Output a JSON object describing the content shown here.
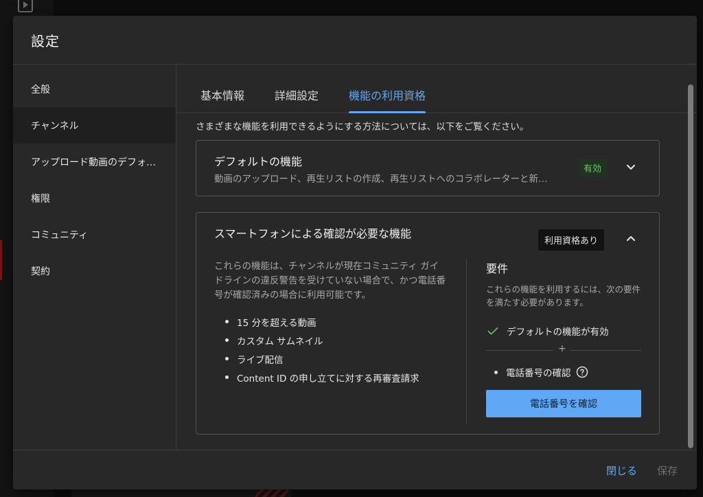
{
  "dialog": {
    "title": "設定"
  },
  "sidebar": {
    "items": [
      {
        "label": "全般"
      },
      {
        "label": "チャンネル"
      },
      {
        "label": "アップロード動画のデフォ…"
      },
      {
        "label": "権限"
      },
      {
        "label": "コミュニティ"
      },
      {
        "label": "契約"
      }
    ],
    "active_index": 1
  },
  "tabs": [
    {
      "label": "基本情報"
    },
    {
      "label": "詳細設定"
    },
    {
      "label": "機能の利用資格"
    }
  ],
  "active_tab_index": 2,
  "intro_text": "さまざまな機能を利用できるようにする方法については、以下をご覧ください。",
  "default_card": {
    "title": "デフォルトの機能",
    "subtitle": "動画のアップロード、再生リストの作成、再生リストへのコラボレーターと新…",
    "status_badge": "有効",
    "chevron_icon": "chevron-down-icon"
  },
  "phone_card": {
    "title": "スマートフォンによる確認が必要な機能",
    "status_badge": "利用資格あり",
    "chevron_icon": "chevron-up-icon",
    "description": "これらの機能は、チャンネルが現在コミュニティ ガイドラインの違反警告を受けていない場合で、かつ電話番号が確認済みの場合に利用可能です。",
    "features": [
      "15 分を超える動画",
      "カスタム サムネイル",
      "ライブ配信",
      "Content ID の申し立てに対する再審査請求"
    ],
    "requirements": {
      "title": "要件",
      "description": "これらの機能を利用するには、次の要件を満たす必要があります。",
      "met_item": "デフォルトの機能が有効",
      "plus": "+",
      "pending_item": "電話番号の確認",
      "verify_button": "電話番号を確認"
    }
  },
  "footer": {
    "close_label": "閉じる",
    "save_label": "保存"
  },
  "colors": {
    "accent": "#5fa8f5",
    "success": "#6bc76b",
    "dialog_bg": "#282828"
  }
}
